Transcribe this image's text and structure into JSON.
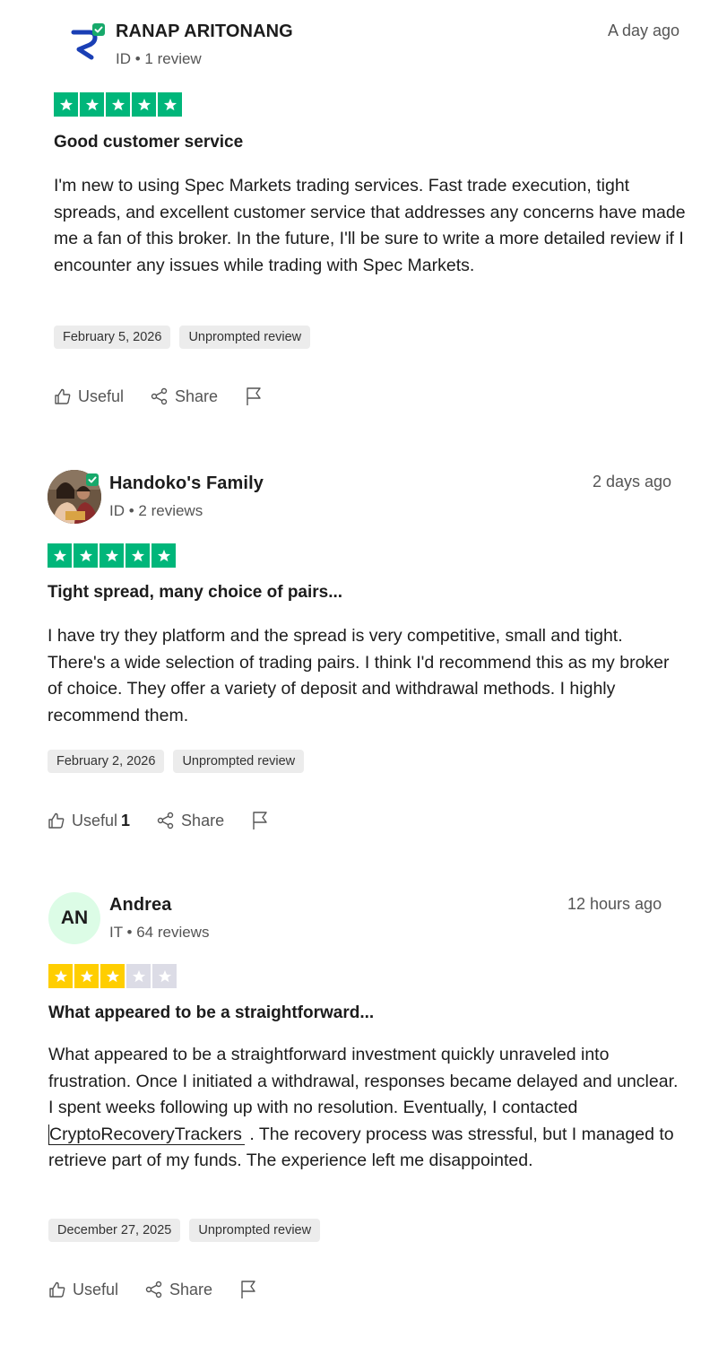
{
  "colors": {
    "star_green": "#00b67a",
    "star_yellow": "#ffce00",
    "star_empty": "#dcdce6",
    "verified_green": "#17a96b",
    "chip_bg": "#ececec"
  },
  "reviews": [
    {
      "reviewer": {
        "name": "RANAP ARITONANG",
        "meta": "ID • 1 review",
        "avatar": "logo",
        "verified": true
      },
      "time_ago": "A day ago",
      "rating": 5,
      "title": "Good customer service",
      "body": "I'm new to using Spec Markets trading services. Fast trade execution, tight spreads, and excellent customer service that addresses any concerns have made me a fan of this broker. In the future, I'll be sure to write a more detailed review if I encounter any issues while trading with Spec Markets.",
      "date": "February 5, 2026",
      "tag": "Unprompted review",
      "useful_label": "Useful",
      "useful_count": "",
      "share_label": "Share"
    },
    {
      "reviewer": {
        "name": "Handoko's Family",
        "meta": "ID • 2 reviews",
        "avatar": "photo",
        "verified": true
      },
      "time_ago": "2 days ago",
      "rating": 5,
      "title": "Tight spread, many choice of pairs...",
      "body": "I have try they platform and the spread is very competitive, small and tight. There's a wide selection of trading pairs. I think I'd recommend this as my broker of choice. They offer a variety of deposit and withdrawal methods. I highly recommend them.",
      "date": "February 2, 2026",
      "tag": "Unprompted review",
      "useful_label": "Useful",
      "useful_count": "1",
      "share_label": "Share"
    },
    {
      "reviewer": {
        "name": "Andrea",
        "meta": "IT • 64 reviews",
        "avatar": "initials",
        "initials": "AN",
        "verified": false
      },
      "time_ago": "12 hours ago",
      "rating": 3,
      "title": "What appeared to be a straightforward...",
      "body_before_link": "What appeared to be a straightforward investment quickly unraveled into frustration. Once I initiated a withdrawal, responses became delayed and unclear. I spent weeks following up with no resolution. Eventually, I contacted ",
      "body_link": "CryptoRecoveryTrackers",
      "body_after_link": " . The recovery process was stressful, but I managed to retrieve part of my funds. The experience left me disappointed.",
      "date": "December 27, 2025",
      "tag": "Unprompted review",
      "useful_label": "Useful",
      "useful_count": "",
      "share_label": "Share"
    }
  ]
}
